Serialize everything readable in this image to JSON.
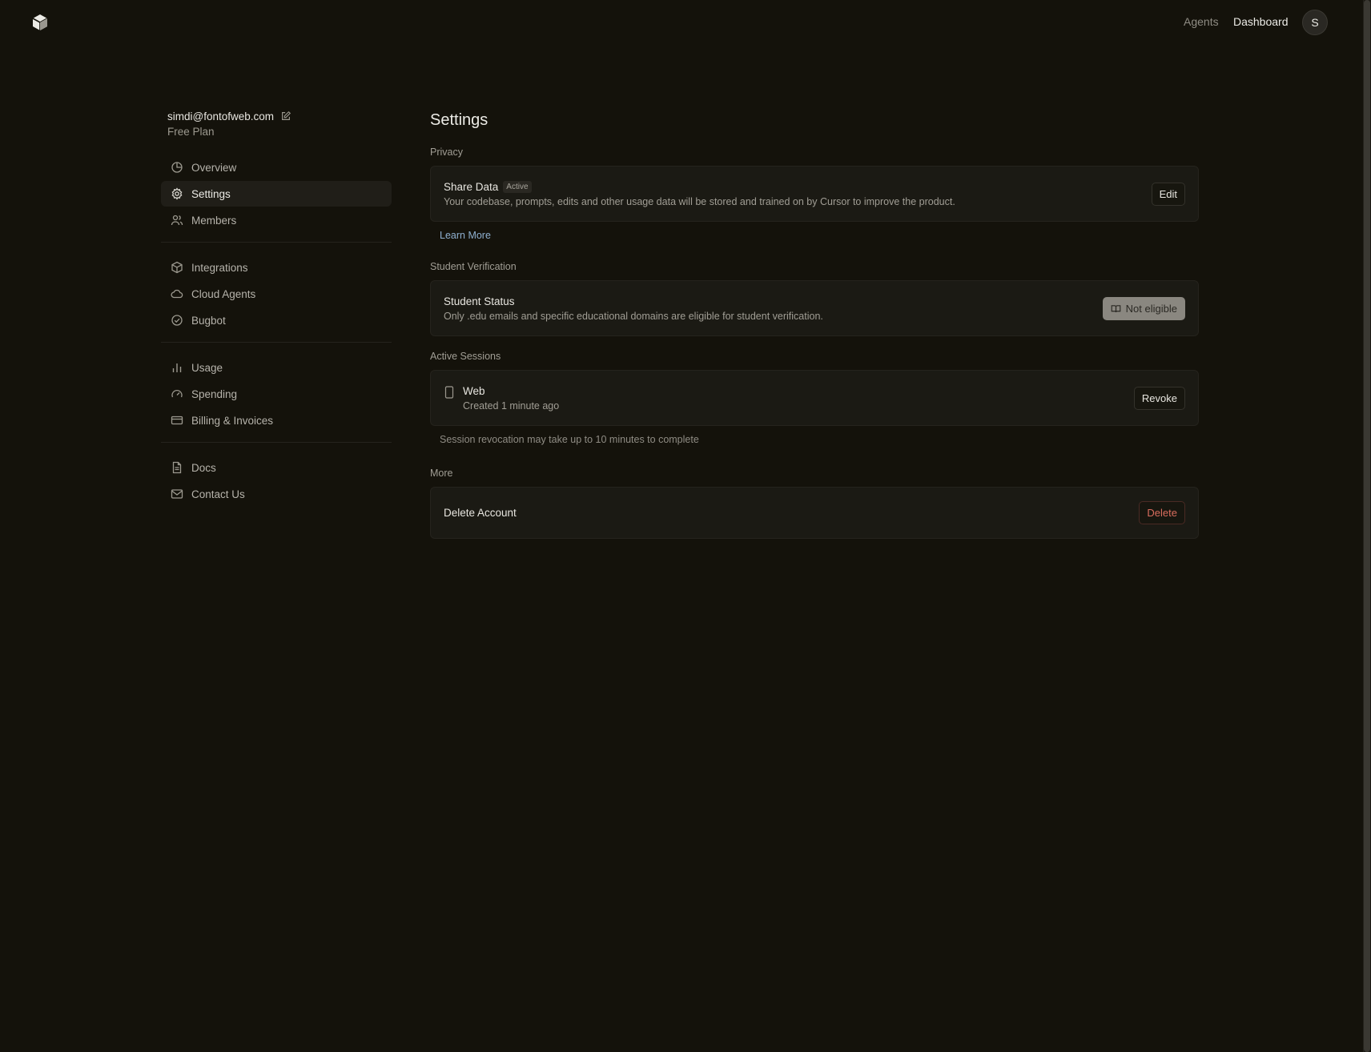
{
  "header": {
    "nav": {
      "agents": "Agents",
      "dashboard": "Dashboard"
    },
    "avatar_initial": "S"
  },
  "sidebar": {
    "email": "simdi@fontofweb.com",
    "plan": "Free Plan",
    "groups": [
      [
        {
          "label": "Overview",
          "icon": "pie-chart-icon"
        },
        {
          "label": "Settings",
          "icon": "gear-icon",
          "active": true
        },
        {
          "label": "Members",
          "icon": "users-icon"
        }
      ],
      [
        {
          "label": "Integrations",
          "icon": "box-icon"
        },
        {
          "label": "Cloud Agents",
          "icon": "cloud-icon"
        },
        {
          "label": "Bugbot",
          "icon": "check-circle-icon"
        }
      ],
      [
        {
          "label": "Usage",
          "icon": "bar-chart-icon"
        },
        {
          "label": "Spending",
          "icon": "gauge-icon"
        },
        {
          "label": "Billing & Invoices",
          "icon": "credit-card-icon"
        }
      ],
      [
        {
          "label": "Docs",
          "icon": "document-icon"
        },
        {
          "label": "Contact Us",
          "icon": "mail-icon"
        }
      ]
    ]
  },
  "main": {
    "title": "Settings",
    "privacy": {
      "label": "Privacy",
      "share_title": "Share Data",
      "share_badge": "Active",
      "share_desc": "Your codebase, prompts, edits and other usage data will be stored and trained on by Cursor to improve the product.",
      "edit_label": "Edit",
      "learn_more": "Learn More"
    },
    "student": {
      "label": "Student Verification",
      "title": "Student Status",
      "desc": "Only .edu emails and specific educational domains are eligible for student verification.",
      "button": "Not eligible"
    },
    "sessions": {
      "label": "Active Sessions",
      "name": "Web",
      "created": "Created 1 minute ago",
      "revoke": "Revoke",
      "note": "Session revocation may take up to 10 minutes to complete"
    },
    "more": {
      "label": "More",
      "delete_title": "Delete Account",
      "delete_button": "Delete"
    }
  },
  "colors": {
    "background": "#14120b",
    "card": "#1b1a14",
    "danger": "#d96d5e",
    "link": "#8fb0d0"
  }
}
